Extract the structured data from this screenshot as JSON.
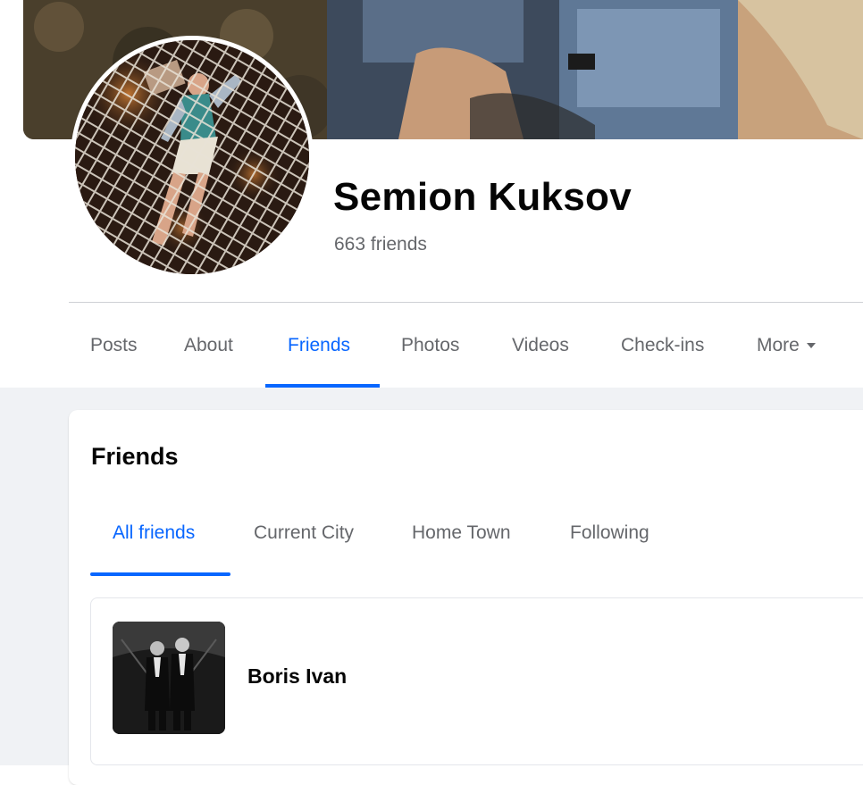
{
  "profile": {
    "name": "Semion Kuksov",
    "friend_count": "663 friends"
  },
  "nav_tabs": [
    {
      "label": "Posts",
      "active": false
    },
    {
      "label": "About",
      "active": false
    },
    {
      "label": "Friends",
      "active": true
    },
    {
      "label": "Photos",
      "active": false
    },
    {
      "label": "Videos",
      "active": false
    },
    {
      "label": "Check-ins",
      "active": false
    },
    {
      "label": "More",
      "active": false,
      "icon": "caret-down-icon"
    }
  ],
  "friends_section": {
    "title": "Friends",
    "subtabs": [
      {
        "label": "All friends",
        "active": true
      },
      {
        "label": "Current City",
        "active": false
      },
      {
        "label": "Home Town",
        "active": false
      },
      {
        "label": "Following",
        "active": false
      }
    ],
    "friends": [
      {
        "name": "Boris Ivan"
      }
    ]
  },
  "colors": {
    "accent": "#0866ff",
    "text_primary": "#050505",
    "text_secondary": "#65676b",
    "page_background": "#f0f2f5"
  }
}
